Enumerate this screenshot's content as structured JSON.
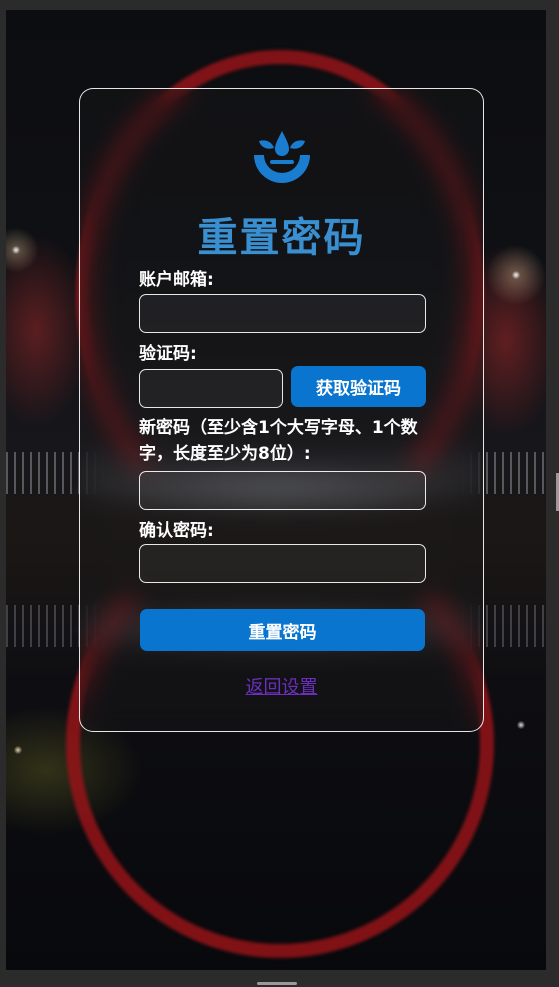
{
  "form": {
    "title": "重置密码",
    "email_label": "账户邮箱:",
    "email_value": "",
    "code_label": "验证码:",
    "code_value": "",
    "get_code_button": "获取验证码",
    "new_password_label": "新密码（至少含1个大写字母、1个数字，长度至少为8位）:",
    "new_password_value": "",
    "confirm_password_label": "确认密码:",
    "confirm_password_value": "",
    "submit_button": "重置密码",
    "back_link": "返回设置"
  },
  "colors": {
    "accent": "#0a75cf",
    "title": "#3a8fd0",
    "link": "#6b2fbf",
    "logo": "#1a7dd0"
  },
  "icons": {
    "logo": "leaf-drops-cup-icon"
  }
}
